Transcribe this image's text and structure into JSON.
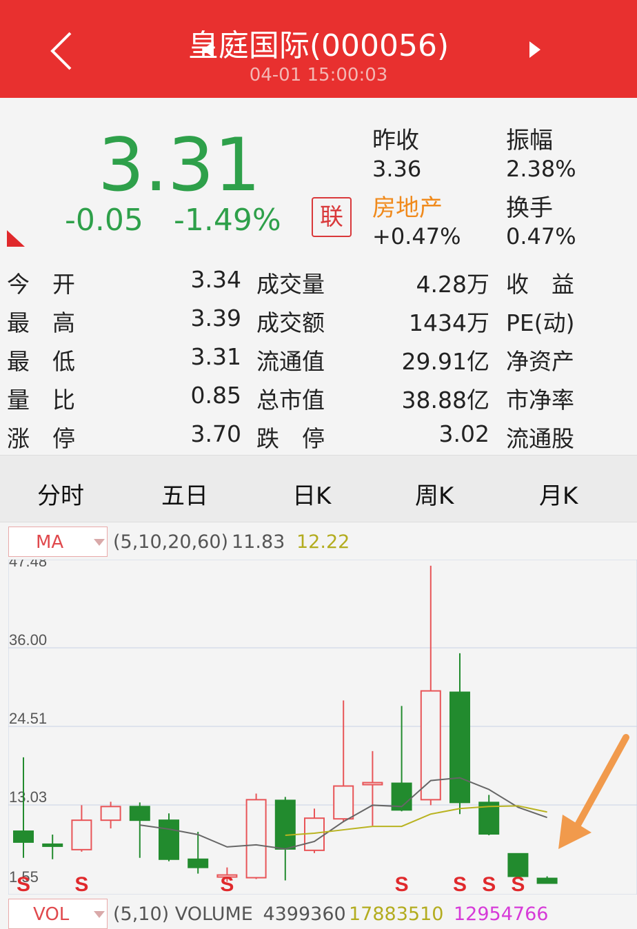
{
  "header": {
    "title": "皇庭国际(000056)",
    "timestamp": "04-01 15:00:03",
    "back_icon": "chevron-left-icon",
    "prev_icon": "triangle-left-icon",
    "next_icon": "triangle-right-icon",
    "bg_color": "#e8302f"
  },
  "quote": {
    "price": "3.31",
    "change": "-0.05",
    "change_pct": "-1.49%",
    "lian_badge": "联",
    "down_color": "#2ea04a"
  },
  "stats_top": {
    "prev_close_label": "昨收",
    "prev_close": "3.36",
    "amplitude_label": "振幅",
    "amplitude": "2.38%",
    "sector_label": "房地产",
    "sector_change": "+0.47%",
    "turnover_label": "换手",
    "turnover": "0.47%"
  },
  "stats_grid": [
    {
      "l1": "今　开",
      "v1": "3.34",
      "l2": "成交量",
      "v2": "4.28万",
      "l3": "收　益"
    },
    {
      "l1": "最　高",
      "v1": "3.39",
      "l2": "成交额",
      "v2": "1434万",
      "l3": "PE(动)"
    },
    {
      "l1": "最　低",
      "v1": "3.31",
      "l2": "流通值",
      "v2": "29.91亿",
      "l3": "净资产"
    },
    {
      "l1": "量　比",
      "v1": "0.85",
      "l2": "总市值",
      "v2": "38.88亿",
      "l3": "市净率"
    },
    {
      "l1": "涨　停",
      "v1": "3.70",
      "l2": "跌　停",
      "v2": "3.02",
      "l3": "流通股"
    }
  ],
  "tabs": [
    "分时",
    "五日",
    "日K",
    "周K",
    "月K"
  ],
  "ma": {
    "label": "MA",
    "params": "(5,10,20,60)",
    "v1": "11.83",
    "v2": "12.22"
  },
  "vol": {
    "label": "VOL",
    "params": "(5,10) VOLUME",
    "v1": "4399360",
    "v2": "17883510",
    "v3": "12954766"
  },
  "chart_data": {
    "type": "candlestick",
    "y_ticks": [
      "47.48",
      "36.00",
      "24.51",
      "13.03",
      "1.55"
    ],
    "ylim": [
      1.55,
      47.48
    ],
    "up_color": "#e85457",
    "down_color": "#228b2e",
    "candles": [
      {
        "o": 9.2,
        "c": 7.6,
        "h": 20.0,
        "l": 5.3
      },
      {
        "o": 7.3,
        "c": 7.1,
        "h": 8.7,
        "l": 5.1
      },
      {
        "o": 6.5,
        "c": 10.8,
        "h": 13.0,
        "l": 6.2
      },
      {
        "o": 10.8,
        "c": 12.8,
        "h": 13.5,
        "l": 9.6
      },
      {
        "o": 12.8,
        "c": 10.8,
        "h": 13.4,
        "l": 5.3
      },
      {
        "o": 10.8,
        "c": 5.1,
        "h": 11.8,
        "l": 4.8
      },
      {
        "o": 5.1,
        "c": 3.9,
        "h": 9.1,
        "l": 3.0
      },
      {
        "o": 2.6,
        "c": 2.8,
        "h": 3.9,
        "l": 1.8
      },
      {
        "o": 2.4,
        "c": 13.8,
        "h": 14.7,
        "l": 2.2
      },
      {
        "o": 13.7,
        "c": 6.6,
        "h": 14.2,
        "l": 2.0
      },
      {
        "o": 6.4,
        "c": 11.1,
        "h": 12.5,
        "l": 6.0
      },
      {
        "o": 11.0,
        "c": 15.8,
        "h": 28.3,
        "l": 10.5
      },
      {
        "o": 16.0,
        "c": 16.3,
        "h": 20.9,
        "l": 10.0
      },
      {
        "o": 16.2,
        "c": 12.3,
        "h": 27.5,
        "l": 12.1
      },
      {
        "o": 13.8,
        "c": 29.7,
        "h": 48.0,
        "l": 13.0
      },
      {
        "o": 29.5,
        "c": 13.4,
        "h": 35.2,
        "l": 11.7
      },
      {
        "o": 13.4,
        "c": 8.8,
        "h": 14.5,
        "l": 8.6
      },
      {
        "o": 5.9,
        "c": 2.6,
        "h": 5.9,
        "l": 2.6
      },
      {
        "o": 2.3,
        "c": 1.6,
        "h": 2.6,
        "l": 1.5
      }
    ],
    "ma_short": {
      "color": "#666666",
      "values": [
        null,
        null,
        null,
        null,
        10.1,
        9.5,
        8.7,
        6.9,
        7.2,
        6.6,
        7.7,
        10.6,
        13.0,
        12.8,
        16.6,
        17.0,
        15.3,
        12.7,
        11.2
      ]
    },
    "ma_long": {
      "color": "#b9b320",
      "values": [
        null,
        null,
        null,
        null,
        null,
        null,
        null,
        null,
        null,
        8.6,
        8.9,
        9.4,
        9.9,
        9.9,
        11.7,
        12.5,
        12.8,
        12.9,
        12.0
      ]
    },
    "signals": [
      0,
      2,
      7,
      13,
      15,
      16,
      17
    ],
    "signal_label": "S",
    "signal_color": "#e0292c"
  }
}
